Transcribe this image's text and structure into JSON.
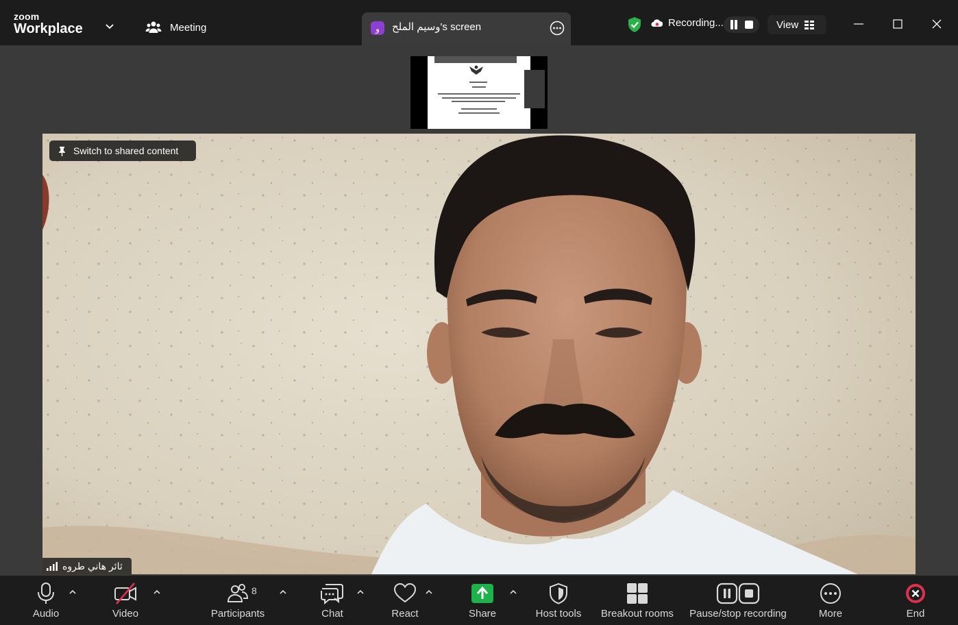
{
  "titlebar": {
    "logo_small": "zoom",
    "logo_big": "Workplace",
    "meeting_label": "Meeting",
    "share_tab": {
      "badge": "و",
      "label": "وسيم الملح's screen"
    },
    "recording_label": "Recording...",
    "view_label": "View"
  },
  "video": {
    "pin_label": "Switch to shared content",
    "participant_name": "ثائر هاني طروه"
  },
  "toolbar": {
    "audio": "Audio",
    "video": "Video",
    "participants": "Participants",
    "participants_count": "8",
    "chat": "Chat",
    "react": "React",
    "share": "Share",
    "host_tools": "Host tools",
    "breakout_rooms": "Breakout rooms",
    "pause_stop_recording": "Pause/stop recording",
    "more": "More",
    "end": "End"
  },
  "colors": {
    "share_green": "#1fb14a",
    "end_red": "#e02f4f",
    "badge_purple": "#8c3fd0",
    "shield_green": "#2ab24a"
  }
}
